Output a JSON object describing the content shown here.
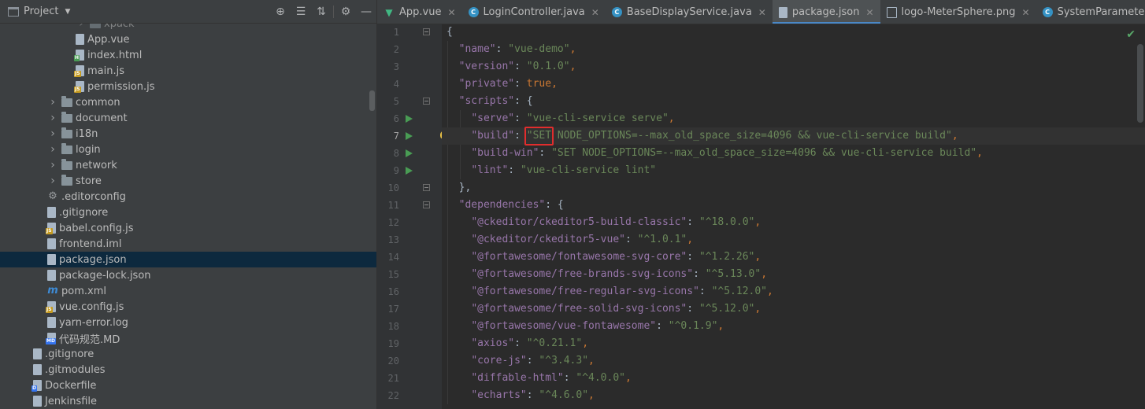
{
  "project_panel": {
    "title": "Project",
    "tool_icons": [
      "locate-icon",
      "expand-all-icon",
      "collapse-all-icon",
      "gear-icon",
      "minimize-icon"
    ],
    "tree": [
      {
        "label": "xpack",
        "type": "folder",
        "depth": 6,
        "expanded": false,
        "dimmed": true
      },
      {
        "label": "App.vue",
        "type": "vue",
        "depth": 5
      },
      {
        "label": "index.html",
        "type": "html",
        "depth": 5
      },
      {
        "label": "main.js",
        "type": "js",
        "depth": 5
      },
      {
        "label": "permission.js",
        "type": "js",
        "depth": 5
      },
      {
        "label": "common",
        "type": "folder",
        "depth": 4,
        "expanded": false
      },
      {
        "label": "document",
        "type": "folder",
        "depth": 4,
        "expanded": false
      },
      {
        "label": "i18n",
        "type": "folder",
        "depth": 4,
        "expanded": false
      },
      {
        "label": "login",
        "type": "folder",
        "depth": 4,
        "expanded": false
      },
      {
        "label": "network",
        "type": "folder",
        "depth": 4,
        "expanded": false
      },
      {
        "label": "store",
        "type": "folder",
        "depth": 4,
        "expanded": false
      },
      {
        "label": ".editorconfig",
        "type": "config",
        "depth": 3
      },
      {
        "label": ".gitignore",
        "type": "ignore",
        "depth": 3
      },
      {
        "label": "babel.config.js",
        "type": "js",
        "depth": 3
      },
      {
        "label": "frontend.iml",
        "type": "iml",
        "depth": 3
      },
      {
        "label": "package.json",
        "type": "json",
        "depth": 3,
        "selected": true
      },
      {
        "label": "package-lock.json",
        "type": "json",
        "depth": 3
      },
      {
        "label": "pom.xml",
        "type": "maven",
        "depth": 3
      },
      {
        "label": "vue.config.js",
        "type": "js",
        "depth": 3
      },
      {
        "label": "yarn-error.log",
        "type": "log",
        "depth": 3
      },
      {
        "label": "代码规范.MD",
        "type": "md",
        "depth": 3
      },
      {
        "label": ".gitignore",
        "type": "ignore",
        "depth": 2
      },
      {
        "label": ".gitmodules",
        "type": "ignore",
        "depth": 2
      },
      {
        "label": "Dockerfile",
        "type": "docker",
        "depth": 2
      },
      {
        "label": "Jenkinsfile",
        "type": "text",
        "depth": 2
      }
    ]
  },
  "editor": {
    "tabs": [
      {
        "label": "App.vue",
        "icon": "vue-icon",
        "active": false
      },
      {
        "label": "LoginController.java",
        "icon": "java-class-icon",
        "active": false
      },
      {
        "label": "BaseDisplayService.java",
        "icon": "java-class-icon",
        "active": false
      },
      {
        "label": "package.json",
        "icon": "json-file-icon",
        "active": true
      },
      {
        "label": "logo-MeterSphere.png",
        "icon": "image-file-icon",
        "active": false
      },
      {
        "label": "SystemParameterExample.j",
        "icon": "java-class-icon",
        "active": false
      }
    ],
    "current_line": 7,
    "lines": [
      {
        "n": "1",
        "tokens": [
          {
            "t": "{",
            "c": "p"
          }
        ],
        "fold": true
      },
      {
        "n": "2",
        "tokens": [
          {
            "t": "  ",
            "c": "p"
          },
          {
            "t": "\"name\"",
            "c": "k"
          },
          {
            "t": ": ",
            "c": "p"
          },
          {
            "t": "\"vue-demo\"",
            "c": "s"
          },
          {
            "t": ",",
            "c": "c"
          }
        ]
      },
      {
        "n": "3",
        "tokens": [
          {
            "t": "  ",
            "c": "p"
          },
          {
            "t": "\"version\"",
            "c": "k"
          },
          {
            "t": ": ",
            "c": "p"
          },
          {
            "t": "\"0.1.0\"",
            "c": "s"
          },
          {
            "t": ",",
            "c": "c"
          }
        ]
      },
      {
        "n": "4",
        "tokens": [
          {
            "t": "  ",
            "c": "p"
          },
          {
            "t": "\"private\"",
            "c": "k"
          },
          {
            "t": ": ",
            "c": "p"
          },
          {
            "t": "true",
            "c": "b"
          },
          {
            "t": ",",
            "c": "c"
          }
        ]
      },
      {
        "n": "5",
        "tokens": [
          {
            "t": "  ",
            "c": "p"
          },
          {
            "t": "\"scripts\"",
            "c": "k"
          },
          {
            "t": ": {",
            "c": "p"
          }
        ],
        "fold": true
      },
      {
        "n": "6",
        "tokens": [
          {
            "t": "    ",
            "c": "p"
          },
          {
            "t": "\"serve\"",
            "c": "k"
          },
          {
            "t": ": ",
            "c": "p"
          },
          {
            "t": "\"vue-cli-service serve\"",
            "c": "s"
          },
          {
            "t": ",",
            "c": "c"
          }
        ],
        "run": true
      },
      {
        "n": "7",
        "tokens": [
          {
            "t": "    ",
            "c": "p"
          },
          {
            "t": "\"build\"",
            "c": "k"
          },
          {
            "t": ": ",
            "c": "p"
          },
          {
            "t": "\"SET NODE_OPTIONS=--max_old_space_size=4096 && vue-cli-service build\"",
            "c": "s"
          },
          {
            "t": ",",
            "c": "c"
          }
        ],
        "run": true,
        "bulb": true
      },
      {
        "n": "8",
        "tokens": [
          {
            "t": "    ",
            "c": "p"
          },
          {
            "t": "\"build-win\"",
            "c": "k"
          },
          {
            "t": ": ",
            "c": "p"
          },
          {
            "t": "\"SET NODE_OPTIONS=--max_old_space_size=4096 && vue-cli-service build\"",
            "c": "s"
          },
          {
            "t": ",",
            "c": "c"
          }
        ],
        "run": true
      },
      {
        "n": "9",
        "tokens": [
          {
            "t": "    ",
            "c": "p"
          },
          {
            "t": "\"lint\"",
            "c": "k"
          },
          {
            "t": ": ",
            "c": "p"
          },
          {
            "t": "\"vue-cli-service lint\"",
            "c": "s"
          }
        ],
        "run": true
      },
      {
        "n": "10",
        "tokens": [
          {
            "t": "  },",
            "c": "p"
          }
        ],
        "fold": true
      },
      {
        "n": "11",
        "tokens": [
          {
            "t": "  ",
            "c": "p"
          },
          {
            "t": "\"dependencies\"",
            "c": "k"
          },
          {
            "t": ": {",
            "c": "p"
          }
        ],
        "fold": true
      },
      {
        "n": "12",
        "tokens": [
          {
            "t": "    ",
            "c": "p"
          },
          {
            "t": "\"@ckeditor/ckeditor5-build-classic\"",
            "c": "k"
          },
          {
            "t": ": ",
            "c": "p"
          },
          {
            "t": "\"^18.0.0\"",
            "c": "s"
          },
          {
            "t": ",",
            "c": "c"
          }
        ]
      },
      {
        "n": "13",
        "tokens": [
          {
            "t": "    ",
            "c": "p"
          },
          {
            "t": "\"@ckeditor/ckeditor5-vue\"",
            "c": "k"
          },
          {
            "t": ": ",
            "c": "p"
          },
          {
            "t": "\"^1.0.1\"",
            "c": "s"
          },
          {
            "t": ",",
            "c": "c"
          }
        ]
      },
      {
        "n": "14",
        "tokens": [
          {
            "t": "    ",
            "c": "p"
          },
          {
            "t": "\"@fortawesome/fontawesome-svg-core\"",
            "c": "k"
          },
          {
            "t": ": ",
            "c": "p"
          },
          {
            "t": "\"^1.2.26\"",
            "c": "s"
          },
          {
            "t": ",",
            "c": "c"
          }
        ]
      },
      {
        "n": "15",
        "tokens": [
          {
            "t": "    ",
            "c": "p"
          },
          {
            "t": "\"@fortawesome/free-brands-svg-icons\"",
            "c": "k"
          },
          {
            "t": ": ",
            "c": "p"
          },
          {
            "t": "\"^5.13.0\"",
            "c": "s"
          },
          {
            "t": ",",
            "c": "c"
          }
        ]
      },
      {
        "n": "16",
        "tokens": [
          {
            "t": "    ",
            "c": "p"
          },
          {
            "t": "\"@fortawesome/free-regular-svg-icons\"",
            "c": "k"
          },
          {
            "t": ": ",
            "c": "p"
          },
          {
            "t": "\"^5.12.0\"",
            "c": "s"
          },
          {
            "t": ",",
            "c": "c"
          }
        ]
      },
      {
        "n": "17",
        "tokens": [
          {
            "t": "    ",
            "c": "p"
          },
          {
            "t": "\"@fortawesome/free-solid-svg-icons\"",
            "c": "k"
          },
          {
            "t": ": ",
            "c": "p"
          },
          {
            "t": "\"^5.12.0\"",
            "c": "s"
          },
          {
            "t": ",",
            "c": "c"
          }
        ]
      },
      {
        "n": "18",
        "tokens": [
          {
            "t": "    ",
            "c": "p"
          },
          {
            "t": "\"@fortawesome/vue-fontawesome\"",
            "c": "k"
          },
          {
            "t": ": ",
            "c": "p"
          },
          {
            "t": "\"^0.1.9\"",
            "c": "s"
          },
          {
            "t": ",",
            "c": "c"
          }
        ]
      },
      {
        "n": "19",
        "tokens": [
          {
            "t": "    ",
            "c": "p"
          },
          {
            "t": "\"axios\"",
            "c": "k"
          },
          {
            "t": ": ",
            "c": "p"
          },
          {
            "t": "\"^0.21.1\"",
            "c": "s"
          },
          {
            "t": ",",
            "c": "c"
          }
        ]
      },
      {
        "n": "20",
        "tokens": [
          {
            "t": "    ",
            "c": "p"
          },
          {
            "t": "\"core-js\"",
            "c": "k"
          },
          {
            "t": ": ",
            "c": "p"
          },
          {
            "t": "\"^3.4.3\"",
            "c": "s"
          },
          {
            "t": ",",
            "c": "c"
          }
        ]
      },
      {
        "n": "21",
        "tokens": [
          {
            "t": "    ",
            "c": "p"
          },
          {
            "t": "\"diffable-html\"",
            "c": "k"
          },
          {
            "t": ": ",
            "c": "p"
          },
          {
            "t": "\"^4.0.0\"",
            "c": "s"
          },
          {
            "t": ",",
            "c": "c"
          }
        ]
      },
      {
        "n": "22",
        "tokens": [
          {
            "t": "    ",
            "c": "p"
          },
          {
            "t": "\"echarts\"",
            "c": "k"
          },
          {
            "t": ": ",
            "c": "p"
          },
          {
            "t": "\"^4.6.0\"",
            "c": "s"
          },
          {
            "t": ",",
            "c": "c"
          }
        ]
      }
    ],
    "highlight_text": "\"SET",
    "status_icon": "check-icon"
  },
  "colors": {
    "background": "#2b2b2b",
    "panel": "#3c3f41",
    "selection": "#0d293e",
    "json_key": "#9876aa",
    "string": "#6a8759",
    "keyword": "#cc7832",
    "highlight_border": "#e12d2d",
    "active_tab_underline": "#4a88c7"
  }
}
